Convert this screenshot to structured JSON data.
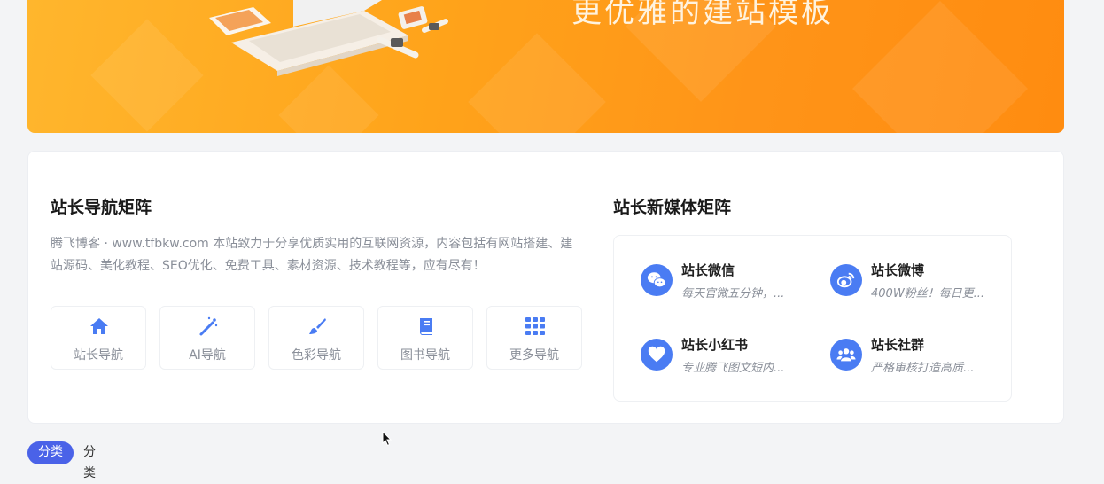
{
  "banner": {
    "title": "更优雅的建站模板"
  },
  "nav_section": {
    "title": "站长导航矩阵",
    "intro": "腾飞博客 · www.tfbkw.com 本站致力于分享优质实用的互联网资源，内容包括有网站搭建、建站源码、美化教程、SEO优化、免费工具、素材资源、技术教程等，应有尽有！",
    "cards": [
      {
        "label": "站长导航",
        "icon": "home-icon"
      },
      {
        "label": "AI导航",
        "icon": "magic-wand-icon"
      },
      {
        "label": "色彩导航",
        "icon": "paint-brush-icon"
      },
      {
        "label": "图书导航",
        "icon": "book-icon"
      },
      {
        "label": "更多导航",
        "icon": "grid-icon"
      }
    ]
  },
  "media_section": {
    "title": "站长新媒体矩阵",
    "items": [
      {
        "title": "站长微信",
        "desc": "每天官微五分钟，...",
        "icon": "wechat-icon"
      },
      {
        "title": "站长微博",
        "desc": "400W粉丝！每日更...",
        "icon": "weibo-icon"
      },
      {
        "title": "站长小红书",
        "desc": "专业腾飞图文短内...",
        "icon": "heart-icon"
      },
      {
        "title": "站长社群",
        "desc": "严格审核打造高质...",
        "icon": "group-icon"
      }
    ]
  },
  "tabs": {
    "active": "分类",
    "other": "分类"
  },
  "colors": {
    "accent": "#4a7cf3",
    "banner": "#ff9a1a",
    "tab_active": "#4a62e8"
  }
}
